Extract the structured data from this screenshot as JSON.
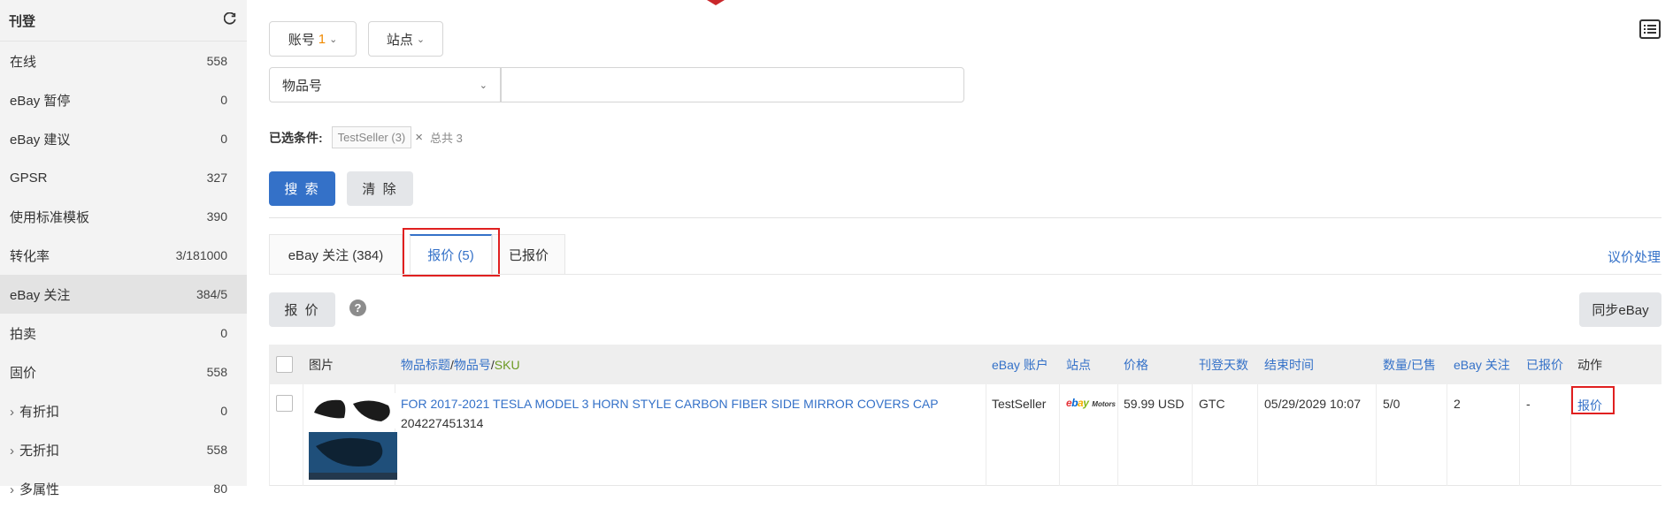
{
  "sidebar": {
    "title": "刊登",
    "items": [
      {
        "label": "在线",
        "count": "558"
      },
      {
        "label": "eBay 暂停",
        "count": "0"
      },
      {
        "label": "eBay 建议",
        "count": "0"
      },
      {
        "label": "GPSR",
        "count": "327"
      },
      {
        "label": "使用标准模板",
        "count": "390"
      },
      {
        "label": "转化率",
        "count": "3/181000"
      },
      {
        "label": "eBay 关注",
        "count": "384/5"
      },
      {
        "label": "拍卖",
        "count": "0"
      },
      {
        "label": "固价",
        "count": "558"
      },
      {
        "label": "有折扣",
        "count": "0"
      },
      {
        "label": "无折扣",
        "count": "558"
      },
      {
        "label": "多属性",
        "count": "80"
      }
    ]
  },
  "filters": {
    "account_label": "账号",
    "account_count": "1",
    "site_label": "站点",
    "field_select": "物品号",
    "search_value": "",
    "selected_label": "已选条件:",
    "selected_tag": "TestSeller (3)",
    "tag_close": "×",
    "total_text": "总共 3",
    "search_button": "搜 索",
    "clear_button": "清 除"
  },
  "tabs": {
    "items": [
      "eBay 关注 (384)",
      "报价 (5)",
      "已报价"
    ],
    "right_link": "议价处理"
  },
  "actions": {
    "quote_button": "报 价",
    "help": "?",
    "sync_button": "同步eBay"
  },
  "table": {
    "headers": {
      "image": "图片",
      "title": "物品标题",
      "sep1": " / ",
      "item_no": "物品号",
      "sep2": " / ",
      "sku": "SKU",
      "account": "eBay 账户",
      "site": "站点",
      "price": "价格",
      "days": "刊登天数",
      "end_time": "结束时间",
      "qty": "数量/已售",
      "watch": "eBay 关注",
      "quoted": "已报价",
      "action": "动作"
    },
    "rows": [
      {
        "title": "FOR 2017-2021 TESLA MODEL 3 HORN STYLE CARBON FIBER SIDE MIRROR COVERS CAP",
        "item_no": "204227451314",
        "account": "TestSeller",
        "site_logo": "ebay",
        "site_logo_sub": "Motors",
        "price": "59.99 USD",
        "days": "GTC",
        "end_time": "05/29/2029 10:07",
        "qty": "5/0",
        "watch": "2",
        "quoted": "-",
        "action": "报价"
      }
    ]
  },
  "colors": {
    "accent": "#3471c8",
    "highlight": "#e02020",
    "sku": "#6b9a22"
  }
}
